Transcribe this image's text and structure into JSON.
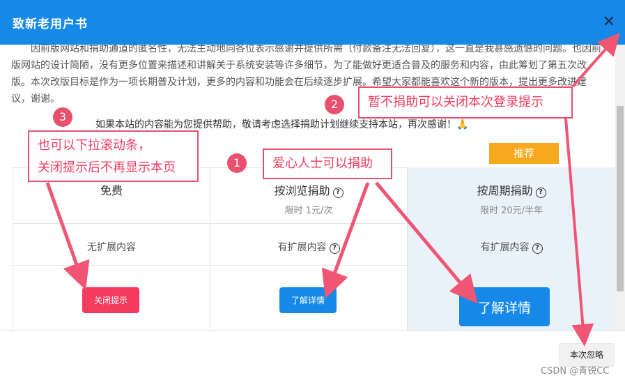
{
  "modal": {
    "title": "致新老用户书",
    "close_glyph": "✕"
  },
  "intro": {
    "paragraph": "因前版网站和捐助通道的匿名性，无法主动地向各位表示感谢并提供所需（付款备注无法回复），这一直是我甚感遗憾的问题。也因前版网站的设计简陋，没有更多位置来描述和讲解关于系统安装等许多细节，为了能做好更适合普及的服务和内容，由此筹划了第五次改版。本次改版目标是作为一项长期普及计划，更多的内容和功能会在后续逐步扩展。希望大家都能喜欢这个新的版本，提出更多改进建议，谢谢。",
    "thanks": "如果本站的内容能为您提供帮助，敬请考虑选择捐助计划继续支持本站，再次感谢！🙏"
  },
  "plans": [
    {
      "name": "免费",
      "price": "",
      "extension": "无扩展内容",
      "button": "关闭提示",
      "help_icon": false
    },
    {
      "name": "按浏览捐助",
      "price": "限时 1元/次",
      "extension": "有扩展内容",
      "button": "了解详情",
      "help_icon": true
    },
    {
      "name": "按周期捐助",
      "price": "限时 20元/半年",
      "extension": "有扩展内容",
      "button": "了解详情",
      "help_icon": true
    }
  ],
  "recommend_badge": "推荐",
  "help_glyph": "?",
  "ignore_button": "本次忽略",
  "annotations": [
    {
      "number": "1",
      "text": "爱心人士可以捐助"
    },
    {
      "number": "2",
      "text": "暂不捐助可以关闭本次登录提示"
    },
    {
      "number": "3",
      "line1": "也可以下拉滚动条，",
      "line2": "关闭提示后不再显示本页"
    }
  ],
  "watermark": "CSDN @青锐CC",
  "colors": {
    "header_blue": "#1688e8",
    "accent_red": "#f53b5e",
    "badge_orange": "#f7a91d",
    "annotation_pink": "#e8506e"
  }
}
